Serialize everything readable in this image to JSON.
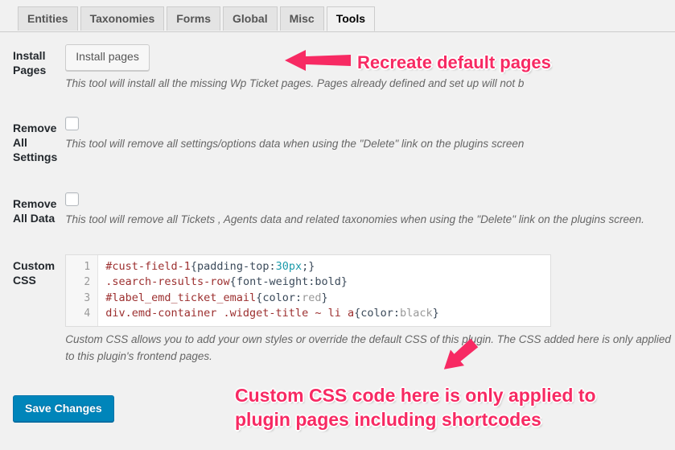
{
  "tabs": [
    {
      "label": "Entities",
      "active": false
    },
    {
      "label": "Taxonomies",
      "active": false
    },
    {
      "label": "Forms",
      "active": false
    },
    {
      "label": "Global",
      "active": false
    },
    {
      "label": "Misc",
      "active": false
    },
    {
      "label": "Tools",
      "active": true
    }
  ],
  "rows": {
    "install_pages": {
      "label": "Install Pages",
      "button_label": "Install pages",
      "description": "This tool will install all the missing Wp Ticket pages. Pages already defined and set up will not b"
    },
    "remove_all_settings": {
      "label": "Remove All Settings",
      "checked": false,
      "description": "This tool will remove all settings/options data when using the \"Delete\" link on the plugins screen"
    },
    "remove_all_data": {
      "label": "Remove All Data",
      "checked": false,
      "description": "This tool will remove all Tickets , Agents data and related taxonomies when using the \"Delete\" link on the plugins screen."
    },
    "custom_css": {
      "label": "Custom CSS",
      "description": "Custom CSS allows you to add your own styles or override the default CSS of this plugin. The CSS added here is only applied to this plugin's frontend pages.",
      "code_lines": [
        {
          "number": "1",
          "selector": "#cust-field-1",
          "open": "{",
          "property": "padding-top:",
          "value": "30px",
          "value_type": "number",
          "tail": ";}"
        },
        {
          "number": "2",
          "selector": ".search-results-row",
          "open": "{",
          "property": "font-weight:bold",
          "value": "",
          "value_type": "none",
          "tail": "}"
        },
        {
          "number": "3",
          "selector": "#label_emd_ticket_email",
          "open": "{",
          "property": "color:",
          "value": "red",
          "value_type": "colorkeyword",
          "tail": "}"
        },
        {
          "number": "4",
          "selector": "div.emd-container .widget-title ~ li a",
          "open": "{",
          "property": "color:",
          "value": "black",
          "value_type": "colorkeyword",
          "tail": "}"
        }
      ]
    }
  },
  "save_button": {
    "label": "Save Changes"
  },
  "annotations": {
    "install_pages_note": "Recreate default pages",
    "custom_css_note": "Custom CSS code here is only applied to plugin pages including shortcodes",
    "color": "#f72a63"
  }
}
